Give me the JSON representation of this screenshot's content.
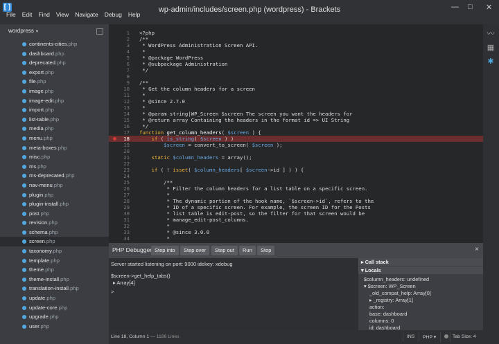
{
  "window": {
    "title": "wp-admin/includes/screen.php (wordpress) - Brackets"
  },
  "menu": [
    "File",
    "Edit",
    "Find",
    "View",
    "Navigate",
    "Debug",
    "Help"
  ],
  "sidebar": {
    "project": "wordpress",
    "files": [
      {
        "name": "continents-cities",
        "ext": ".php"
      },
      {
        "name": "dashboard",
        "ext": ".php"
      },
      {
        "name": "deprecated",
        "ext": ".php"
      },
      {
        "name": "export",
        "ext": ".php"
      },
      {
        "name": "file",
        "ext": ".php"
      },
      {
        "name": "image",
        "ext": ".php"
      },
      {
        "name": "image-edit",
        "ext": ".php"
      },
      {
        "name": "import",
        "ext": ".php"
      },
      {
        "name": "list-table",
        "ext": ".php"
      },
      {
        "name": "media",
        "ext": ".php"
      },
      {
        "name": "menu",
        "ext": ".php"
      },
      {
        "name": "meta-boxes",
        "ext": ".php"
      },
      {
        "name": "misc",
        "ext": ".php"
      },
      {
        "name": "ms",
        "ext": ".php"
      },
      {
        "name": "ms-deprecated",
        "ext": ".php"
      },
      {
        "name": "nav-menu",
        "ext": ".php"
      },
      {
        "name": "plugin",
        "ext": ".php"
      },
      {
        "name": "plugin-install",
        "ext": ".php"
      },
      {
        "name": "post",
        "ext": ".php"
      },
      {
        "name": "revision",
        "ext": ".php"
      },
      {
        "name": "schema",
        "ext": ".php"
      },
      {
        "name": "screen",
        "ext": ".php"
      },
      {
        "name": "taxonomy",
        "ext": ".php"
      },
      {
        "name": "template",
        "ext": ".php"
      },
      {
        "name": "theme",
        "ext": ".php"
      },
      {
        "name": "theme-install",
        "ext": ".php"
      },
      {
        "name": "translation-install",
        "ext": ".php"
      },
      {
        "name": "update",
        "ext": ".php"
      },
      {
        "name": "update-core",
        "ext": ".php"
      },
      {
        "name": "upgrade",
        "ext": ".php"
      },
      {
        "name": "user",
        "ext": ".php"
      }
    ],
    "selected": "screen"
  },
  "editor": {
    "highlight_line": 18,
    "lines": [
      {
        "n": "1",
        "t": "<?php",
        "c": "fn"
      },
      {
        "n": "2",
        "t": "/**",
        "c": "cmt"
      },
      {
        "n": "3",
        "t": " * WordPress Administration Screen API.",
        "c": "cmt"
      },
      {
        "n": "4",
        "t": " *",
        "c": "cmt"
      },
      {
        "n": "5",
        "t": " * @package WordPress",
        "c": "cmt"
      },
      {
        "n": "6",
        "t": " * @subpackage Administration",
        "c": "cmt"
      },
      {
        "n": "7",
        "t": " */",
        "c": "cmt"
      },
      {
        "n": "8",
        "t": "",
        "c": "cmt"
      },
      {
        "n": "9",
        "t": "/**",
        "c": "cmt"
      },
      {
        "n": "10",
        "t": " * Get the column headers for a screen",
        "c": "cmt"
      },
      {
        "n": "11",
        "t": " *",
        "c": "cmt"
      },
      {
        "n": "12",
        "t": " * @since 2.7.0",
        "c": "cmt"
      },
      {
        "n": "13",
        "t": " *",
        "c": "cmt"
      },
      {
        "n": "14",
        "t": " * @param string|WP_Screen $screen The screen you want the headers for",
        "c": "cmt"
      },
      {
        "n": "15",
        "t": " * @return array Containing the headers in the format id => UI String",
        "c": "cmt"
      },
      {
        "n": "16",
        "t": " */",
        "c": "cmt"
      },
      {
        "n": "17",
        "parts": [
          [
            "function ",
            "kw"
          ],
          [
            "get_column_headers",
            "fn"
          ],
          [
            "( ",
            ""
          ],
          [
            "$screen",
            "var"
          ],
          [
            " ) {",
            ""
          ]
        ]
      },
      {
        "n": "18",
        "parts": [
          [
            "    if",
            "kw"
          ],
          [
            " ( ",
            ""
          ],
          [
            "is_string",
            "var"
          ],
          [
            "( ",
            ""
          ],
          [
            "$screen",
            "var"
          ],
          [
            " ) )",
            ""
          ]
        ]
      },
      {
        "n": "19",
        "parts": [
          [
            "        ",
            ""
          ],
          [
            "$screen",
            "var"
          ],
          [
            " = convert_to_screen( ",
            ""
          ],
          [
            "$screen",
            "var"
          ],
          [
            " );",
            ""
          ]
        ]
      },
      {
        "n": "20",
        "t": "",
        "c": ""
      },
      {
        "n": "21",
        "parts": [
          [
            "    static ",
            "kw"
          ],
          [
            "$column_headers",
            "var"
          ],
          [
            " = array();",
            ""
          ]
        ]
      },
      {
        "n": "22",
        "t": "",
        "c": ""
      },
      {
        "n": "23",
        "parts": [
          [
            "    if",
            "kw"
          ],
          [
            " ( ! ",
            ""
          ],
          [
            "isset",
            "kw"
          ],
          [
            "( ",
            ""
          ],
          [
            "$column_headers",
            "var"
          ],
          [
            "[ ",
            ""
          ],
          [
            "$screen",
            "var"
          ],
          [
            "->id ] ) ) {",
            ""
          ]
        ]
      },
      {
        "n": "24",
        "t": "",
        "c": ""
      },
      {
        "n": "25",
        "t": "        /**",
        "c": "cmt"
      },
      {
        "n": "26",
        "t": "         * Filter the column headers for a list table on a specific screen.",
        "c": "cmt"
      },
      {
        "n": "27",
        "t": "         *",
        "c": "cmt"
      },
      {
        "n": "28",
        "t": "         * The dynamic portion of the hook name, `$screen->id`, refers to the",
        "c": "cmt"
      },
      {
        "n": "29",
        "t": "         * ID of a specific screen. For example, the screen ID for the Posts",
        "c": "cmt"
      },
      {
        "n": "30",
        "t": "         * list table is edit-post, so the filter for that screen would be",
        "c": "cmt"
      },
      {
        "n": "31",
        "t": "         * manage_edit-post_columns.",
        "c": "cmt"
      },
      {
        "n": "32",
        "t": "         *",
        "c": "cmt"
      },
      {
        "n": "33",
        "t": "         * @since 3.0.0",
        "c": "cmt"
      },
      {
        "n": "34",
        "t": "         *",
        "c": "cmt"
      }
    ]
  },
  "debugger": {
    "title": "PHP Debugger",
    "buttons": [
      "Step into",
      "Step over",
      "Step out",
      "Run",
      "Stop"
    ],
    "close": "×",
    "console": [
      "Server started listening on port: 9000 idekey: xdebug",
      "$screen->get_help_tabs()",
      "▸ Array[4]",
      ">"
    ],
    "callstack_label": "Call stack",
    "locals_label": "Locals",
    "locals": [
      {
        "t": "$column_headers: undefined",
        "indent": 0
      },
      {
        "t": "▾ $screen: WP_Screen",
        "indent": 0
      },
      {
        "t": "_old_compat_help: Array[0]",
        "indent": 1
      },
      {
        "t": "▸ _registry: Array[1]",
        "indent": 1
      },
      {
        "t": "action:",
        "indent": 1
      },
      {
        "t": "base: dashboard",
        "indent": 1
      },
      {
        "t": "columns: 0",
        "indent": 1
      },
      {
        "t": "id: dashboard",
        "indent": 1
      }
    ]
  },
  "status": {
    "position": "Line 18, Column 1",
    "lines": "— 1186 Lines",
    "mode": "INS",
    "language": "PHP ▾",
    "tab": "Tab Size: 4"
  },
  "colors": {
    "accent": "#2f87d6",
    "breakpoint": "#d23a3a",
    "highlight": "#6b2d2e",
    "keyword": "#f2b43c",
    "variable": "#6aa7e0"
  }
}
